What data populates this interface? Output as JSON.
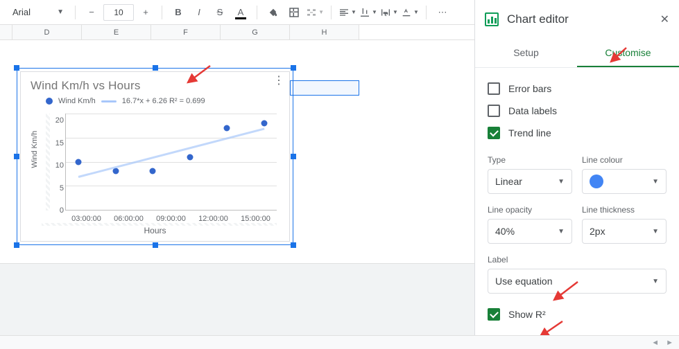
{
  "toolbar": {
    "font_name": "Arial",
    "font_size": "10"
  },
  "columns": [
    "D",
    "E",
    "F",
    "G",
    "H"
  ],
  "chart_data": {
    "type": "scatter",
    "title": "Wind Km/h vs Hours",
    "xlabel": "Hours",
    "ylabel": "Wind Km/h",
    "ylim": [
      0,
      20
    ],
    "yticks": [
      0,
      5,
      10,
      15,
      20
    ],
    "xticks": [
      "03:00:00",
      "06:00:00",
      "09:00:00",
      "12:00:00",
      "15:00:00"
    ],
    "series": [
      {
        "name": "Wind Km/h",
        "x": [
          "03:00:00",
          "06:00:00",
          "09:00:00",
          "12:00:00",
          "15:00:00"
        ],
        "y": [
          10,
          8,
          8,
          11,
          17,
          18
        ]
      }
    ],
    "trendline": {
      "equation": "16.7*x + 6.26 R² = 0.699",
      "type": "Linear"
    },
    "legend_equation": "16.7*x + 6.26 R² = 0.699"
  },
  "editor": {
    "title": "Chart editor",
    "tabs": {
      "setup": "Setup",
      "customise": "Customise"
    },
    "checks": {
      "error_bars": "Error bars",
      "data_labels": "Data labels",
      "trend_line": "Trend line",
      "show_r2": "Show R²"
    },
    "labels": {
      "type": "Type",
      "line_colour": "Line colour",
      "line_opacity": "Line opacity",
      "line_thickness": "Line thickness",
      "label": "Label"
    },
    "values": {
      "type": "Linear",
      "opacity": "40%",
      "thickness": "2px",
      "label_mode": "Use equation"
    }
  }
}
